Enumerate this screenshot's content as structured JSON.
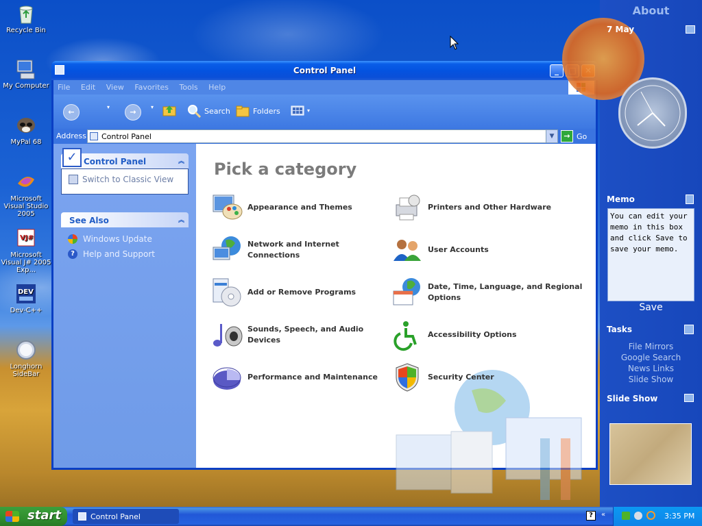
{
  "desktop": {
    "icons": [
      {
        "label": "Recycle Bin"
      },
      {
        "label": "My Computer"
      },
      {
        "label": "MyPal 68"
      },
      {
        "label": "Microsoft Visual Studio 2005"
      },
      {
        "label": "Microsoft Visual J# 2005 Exp..."
      },
      {
        "label": "Dev-C++"
      },
      {
        "label": "Longhorn SideBar"
      }
    ]
  },
  "window": {
    "title": "Control Panel",
    "menu": [
      "File",
      "Edit",
      "View",
      "Favorites",
      "Tools",
      "Help"
    ],
    "toolbar": {
      "search_label": "Search",
      "folders_label": "Folders"
    },
    "address": {
      "label": "Address",
      "value": "Control Panel",
      "go_label": "Go"
    },
    "left_panel": {
      "control_panel_title": "Control Panel",
      "switch_label": "Switch to Classic View",
      "see_also_title": "See Also",
      "see_also_items": [
        "Windows Update",
        "Help and Support"
      ]
    },
    "heading": "Pick a category",
    "categories": [
      "Appearance and Themes",
      "Printers and Other Hardware",
      "Network and Internet Connections",
      "User Accounts",
      "Add or Remove Programs",
      "Date, Time, Language, and Regional Options",
      "Sounds, Speech, and Audio Devices",
      "Accessibility Options",
      "Performance and Maintenance",
      "Security Center"
    ]
  },
  "sidebar": {
    "about_label": "About",
    "date": "7 May",
    "memo_title": "Memo",
    "memo_text": "You can edit your memo in this box and click Save to save your memo.",
    "save_label": "Save",
    "tasks_title": "Tasks",
    "tasks": [
      "File Mirrors",
      "Google Search",
      "News Links",
      "Slide Show"
    ],
    "slideshow_title": "Slide Show"
  },
  "taskbar": {
    "start_label": "start",
    "task_label": "Control Panel",
    "clock": "3:35 PM"
  }
}
